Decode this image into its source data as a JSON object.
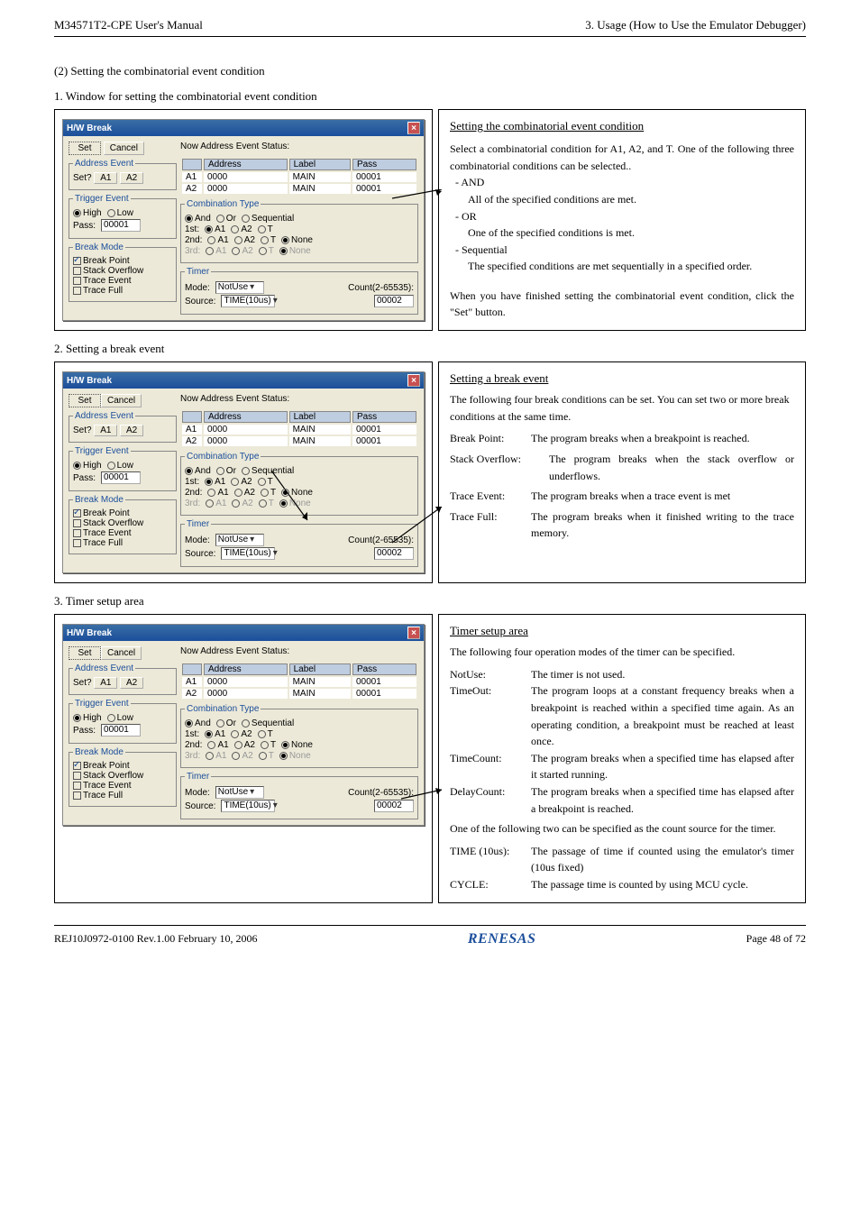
{
  "header": {
    "left": "M34571T2-CPE User's Manual",
    "right": "3. Usage (How to Use the Emulator Debugger)"
  },
  "s1_title": "(2) Setting the combinatorial event condition",
  "s1_sub": "1. Window for setting the combinatorial event condition",
  "s2_sub": "2. Setting a break event",
  "s3_sub": "3. Timer setup area",
  "win": {
    "title": "H/W Break",
    "set": "Set",
    "cancel": "Cancel",
    "addr_legend": "Address Event",
    "setq": "Set?",
    "a1": "A1",
    "a2": "A2",
    "trig_legend": "Trigger Event",
    "high": "High",
    "low": "Low",
    "pass": "Pass:",
    "pass_val": "00001",
    "break_legend": "Break Mode",
    "bp": "Break Point",
    "so": "Stack Overflow",
    "te": "Trace Event",
    "tf": "Trace Full",
    "status_title": "Now Address Event Status:",
    "th_addr": "Address",
    "th_lab": "Label",
    "th_pass": "Pass",
    "row1_a": "A1",
    "row1_b": "0000",
    "row1_c": "MAIN",
    "row1_d": "00001",
    "row2_a": "A2",
    "row2_b": "0000",
    "row2_c": "MAIN",
    "row2_d": "00001",
    "comb_legend": "Combination Type",
    "and": "And",
    "or": "Or",
    "seq": "Sequential",
    "first": "1st:",
    "second": "2nd:",
    "third": "3rd:",
    "opt_a1": "A1",
    "opt_a2": "A2",
    "opt_t": "T",
    "opt_none": "None",
    "timer_legend": "Timer",
    "mode": "Mode:",
    "mode_val": "NotUse",
    "count": "Count(2-65535):",
    "count_val": "00002",
    "source": "Source:",
    "source_val": "TIME(10us)"
  },
  "r1": {
    "title": "Setting the combinatorial event condition",
    "p1": "Select a combinatorial condition for A1, A2, and T. One of the following three combinatorial conditions can be selected..",
    "and_l": "-  AND",
    "and_t": "All of the specified conditions are met.",
    "or_l": "-  OR",
    "or_t": "One of the specified conditions is met.",
    "seq_l": "-  Sequential",
    "seq_t": "The specified conditions are met sequentially in a specified order.",
    "p2": "When you have finished setting the combinatorial event condition, click the \"Set\" button."
  },
  "r2": {
    "title": "Setting a break event",
    "p1": "The following four break conditions can be set. You can set two or more break conditions at the same time.",
    "bp_l": "Break Point:",
    "bp_t": "The program breaks when a breakpoint is reached.",
    "so_l": "Stack Overflow:",
    "so_t": "The program breaks when the stack overflow or underflows.",
    "te_l": "Trace Event:",
    "te_t": "The program breaks when a trace event is met",
    "tf_l": "Trace Full:",
    "tf_t": "The program breaks when it finished writing to the trace memory."
  },
  "r3": {
    "title": "Timer setup area",
    "p1": "The following four operation modes of the timer can be specified.",
    "nu_l": "NotUse:",
    "nu_t": "The timer is not used.",
    "to_l": "TimeOut:",
    "to_t": "The program loops at a constant frequency breaks when a breakpoint is reached within a specified time again. As an operating condition, a breakpoint must be reached at least once.",
    "tc_l": "TimeCount:",
    "tc_t": "The program breaks when a specified time has elapsed after it started running.",
    "dc_l": "DelayCount:",
    "dc_t": "The program breaks when a specified time has elapsed after a breakpoint is reached.",
    "p2": "One of the following two can be specified as the count source for the timer.",
    "ti_l": "TIME (10us):",
    "ti_t": "The passage of time if counted using the emulator's timer (10us fixed)",
    "cy_l": "CYCLE:",
    "cy_t": "The passage time is counted by using MCU cycle."
  },
  "footer": {
    "left": "REJ10J0972-0100  Rev.1.00   February 10, 2006",
    "logo": "RENESAS",
    "right": "Page 48 of 72"
  }
}
